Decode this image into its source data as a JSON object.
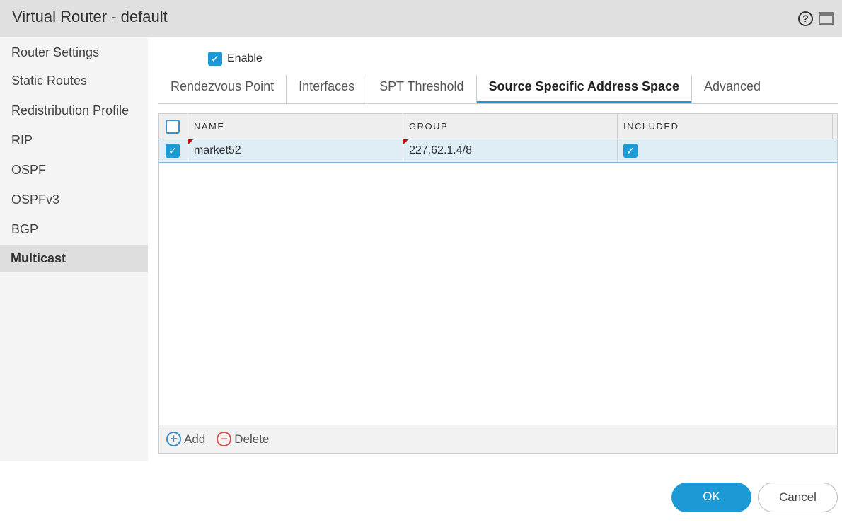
{
  "window": {
    "title": "Virtual Router - default",
    "help_icon": "?"
  },
  "sidebar": {
    "items": [
      {
        "label": "Router Settings"
      },
      {
        "label": "Static Routes"
      },
      {
        "label": "Redistribution Profile"
      },
      {
        "label": "RIP"
      },
      {
        "label": "OSPF"
      },
      {
        "label": "OSPFv3"
      },
      {
        "label": "BGP"
      },
      {
        "label": "Multicast",
        "active": true
      }
    ]
  },
  "enable": {
    "label": "Enable",
    "checked": true
  },
  "tabs": [
    {
      "label": "Rendezvous Point"
    },
    {
      "label": "Interfaces"
    },
    {
      "label": "SPT Threshold"
    },
    {
      "label": "Source Specific Address Space",
      "active": true
    },
    {
      "label": "Advanced"
    }
  ],
  "table": {
    "columns": [
      "NAME",
      "GROUP",
      "INCLUDED"
    ],
    "rows": [
      {
        "name": "market52",
        "group": "227.62.1.4/8",
        "included": true,
        "selected": true
      }
    ]
  },
  "footer": {
    "add": "Add",
    "delete": "Delete"
  },
  "buttons": {
    "ok": "OK",
    "cancel": "Cancel"
  },
  "icons": {
    "check": "✓",
    "plus": "+",
    "minus": "−"
  }
}
